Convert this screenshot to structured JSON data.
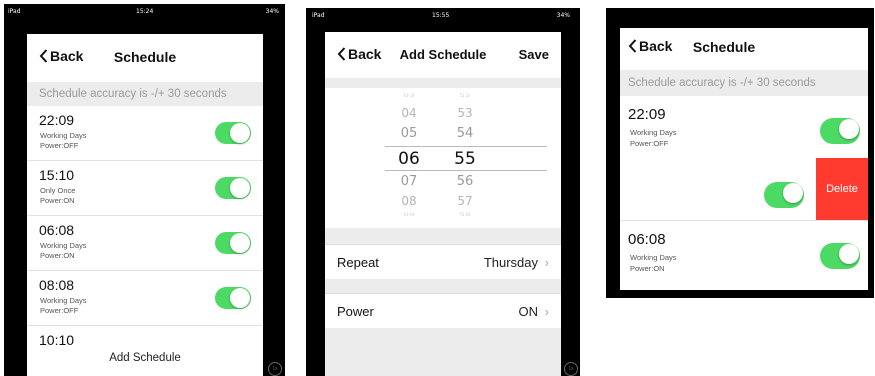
{
  "panel1": {
    "status": {
      "left": "iPad",
      "time": "15:24",
      "right": "34%"
    },
    "nav": {
      "back": "Back",
      "title": "Schedule"
    },
    "info": "Schedule accuracy is -/+ 30 seconds",
    "rows": [
      {
        "time": "22:09",
        "days": "Working Days",
        "power": "Power:OFF",
        "on": true
      },
      {
        "time": "15:10",
        "days": "Only Once",
        "power": "Power:ON",
        "on": true
      },
      {
        "time": "06:08",
        "days": "Working Days",
        "power": "Power:ON",
        "on": true
      },
      {
        "time": "08:08",
        "days": "Working Days",
        "power": "Power:OFF",
        "on": true
      },
      {
        "time": "10:10"
      }
    ],
    "add_label": "Add Schedule",
    "badge": "1x"
  },
  "panel2": {
    "status": {
      "left": "iPad",
      "time": "15:55",
      "right": "34%"
    },
    "nav": {
      "back": "Back",
      "title": "Add Schedule",
      "save": "Save"
    },
    "picker": {
      "hours": [
        "03",
        "04",
        "05",
        "06",
        "07",
        "08",
        "09"
      ],
      "minutes": [
        "52",
        "53",
        "54",
        "55",
        "56",
        "57",
        "58"
      ],
      "selected_hour": "06",
      "selected_minute": "55"
    },
    "repeat": {
      "label": "Repeat",
      "value": "Thursday"
    },
    "power": {
      "label": "Power",
      "value": "ON"
    },
    "badge": "1x"
  },
  "panel3": {
    "nav": {
      "back": "Back",
      "title": "Schedule"
    },
    "info": "Schedule accuracy is -/+ 30 seconds",
    "rows": [
      {
        "time": "22:09",
        "days": "Working Days",
        "power": "Power:OFF",
        "on": true
      },
      {
        "time": "06:08",
        "days": "Working Days",
        "power": "Power:ON",
        "on": true
      }
    ],
    "delete_label": "Delete"
  },
  "colors": {
    "toggle_on": "#4cd964",
    "delete": "#ff3b30",
    "band": "#ececec"
  }
}
